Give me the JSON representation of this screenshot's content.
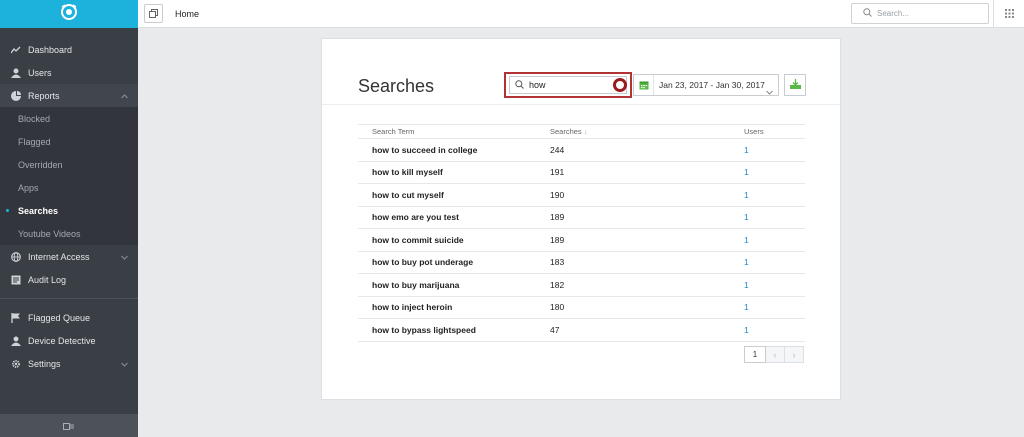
{
  "sidebar": {
    "items": [
      {
        "label": "Dashboard",
        "icon": "chart-line-icon"
      },
      {
        "label": "Users",
        "icon": "user-icon"
      },
      {
        "label": "Reports",
        "icon": "pie-chart-icon"
      }
    ],
    "report_subitems": [
      "Blocked",
      "Flagged",
      "Overridden",
      "Apps",
      "Searches",
      "Youtube Videos"
    ],
    "active_subitem": "Searches",
    "items_after": [
      {
        "label": "Internet Access",
        "icon": "globe-icon"
      },
      {
        "label": "Audit Log",
        "icon": "log-icon"
      }
    ],
    "items_bottom": [
      {
        "label": "Flagged Queue",
        "icon": "flag-icon"
      },
      {
        "label": "Device Detective",
        "icon": "user-icon"
      },
      {
        "label": "Settings",
        "icon": "gear-icon"
      }
    ]
  },
  "topbar": {
    "breadcrumb": "Home",
    "search_placeholder": "Search..."
  },
  "main": {
    "title": "Searches",
    "filter_value": "how",
    "date_range": "Jan 23, 2017 - Jan 30, 2017",
    "columns": [
      "Search Term",
      "Searches",
      "Users"
    ],
    "sort_indicator": "↓",
    "rows": [
      {
        "term": "how to succeed in college",
        "searches": "244",
        "users": "1"
      },
      {
        "term": "how to kill myself",
        "searches": "191",
        "users": "1"
      },
      {
        "term": "how to cut myself",
        "searches": "190",
        "users": "1"
      },
      {
        "term": "how emo are you test",
        "searches": "189",
        "users": "1"
      },
      {
        "term": "how to commit suicide",
        "searches": "189",
        "users": "1"
      },
      {
        "term": "how to buy pot underage",
        "searches": "183",
        "users": "1"
      },
      {
        "term": "how to buy marijuana",
        "searches": "182",
        "users": "1"
      },
      {
        "term": "how to inject heroin",
        "searches": "180",
        "users": "1"
      },
      {
        "term": "how to bypass lightspeed",
        "searches": "47",
        "users": "1"
      }
    ],
    "pagination": {
      "current_page": "1",
      "prev": "‹",
      "next": "›"
    }
  },
  "colors": {
    "brand": "#1cb2dc",
    "sidebar": "#3a3f46",
    "link": "#1c8ad1",
    "highlight": "#b23333",
    "accent_green": "#58b947"
  }
}
